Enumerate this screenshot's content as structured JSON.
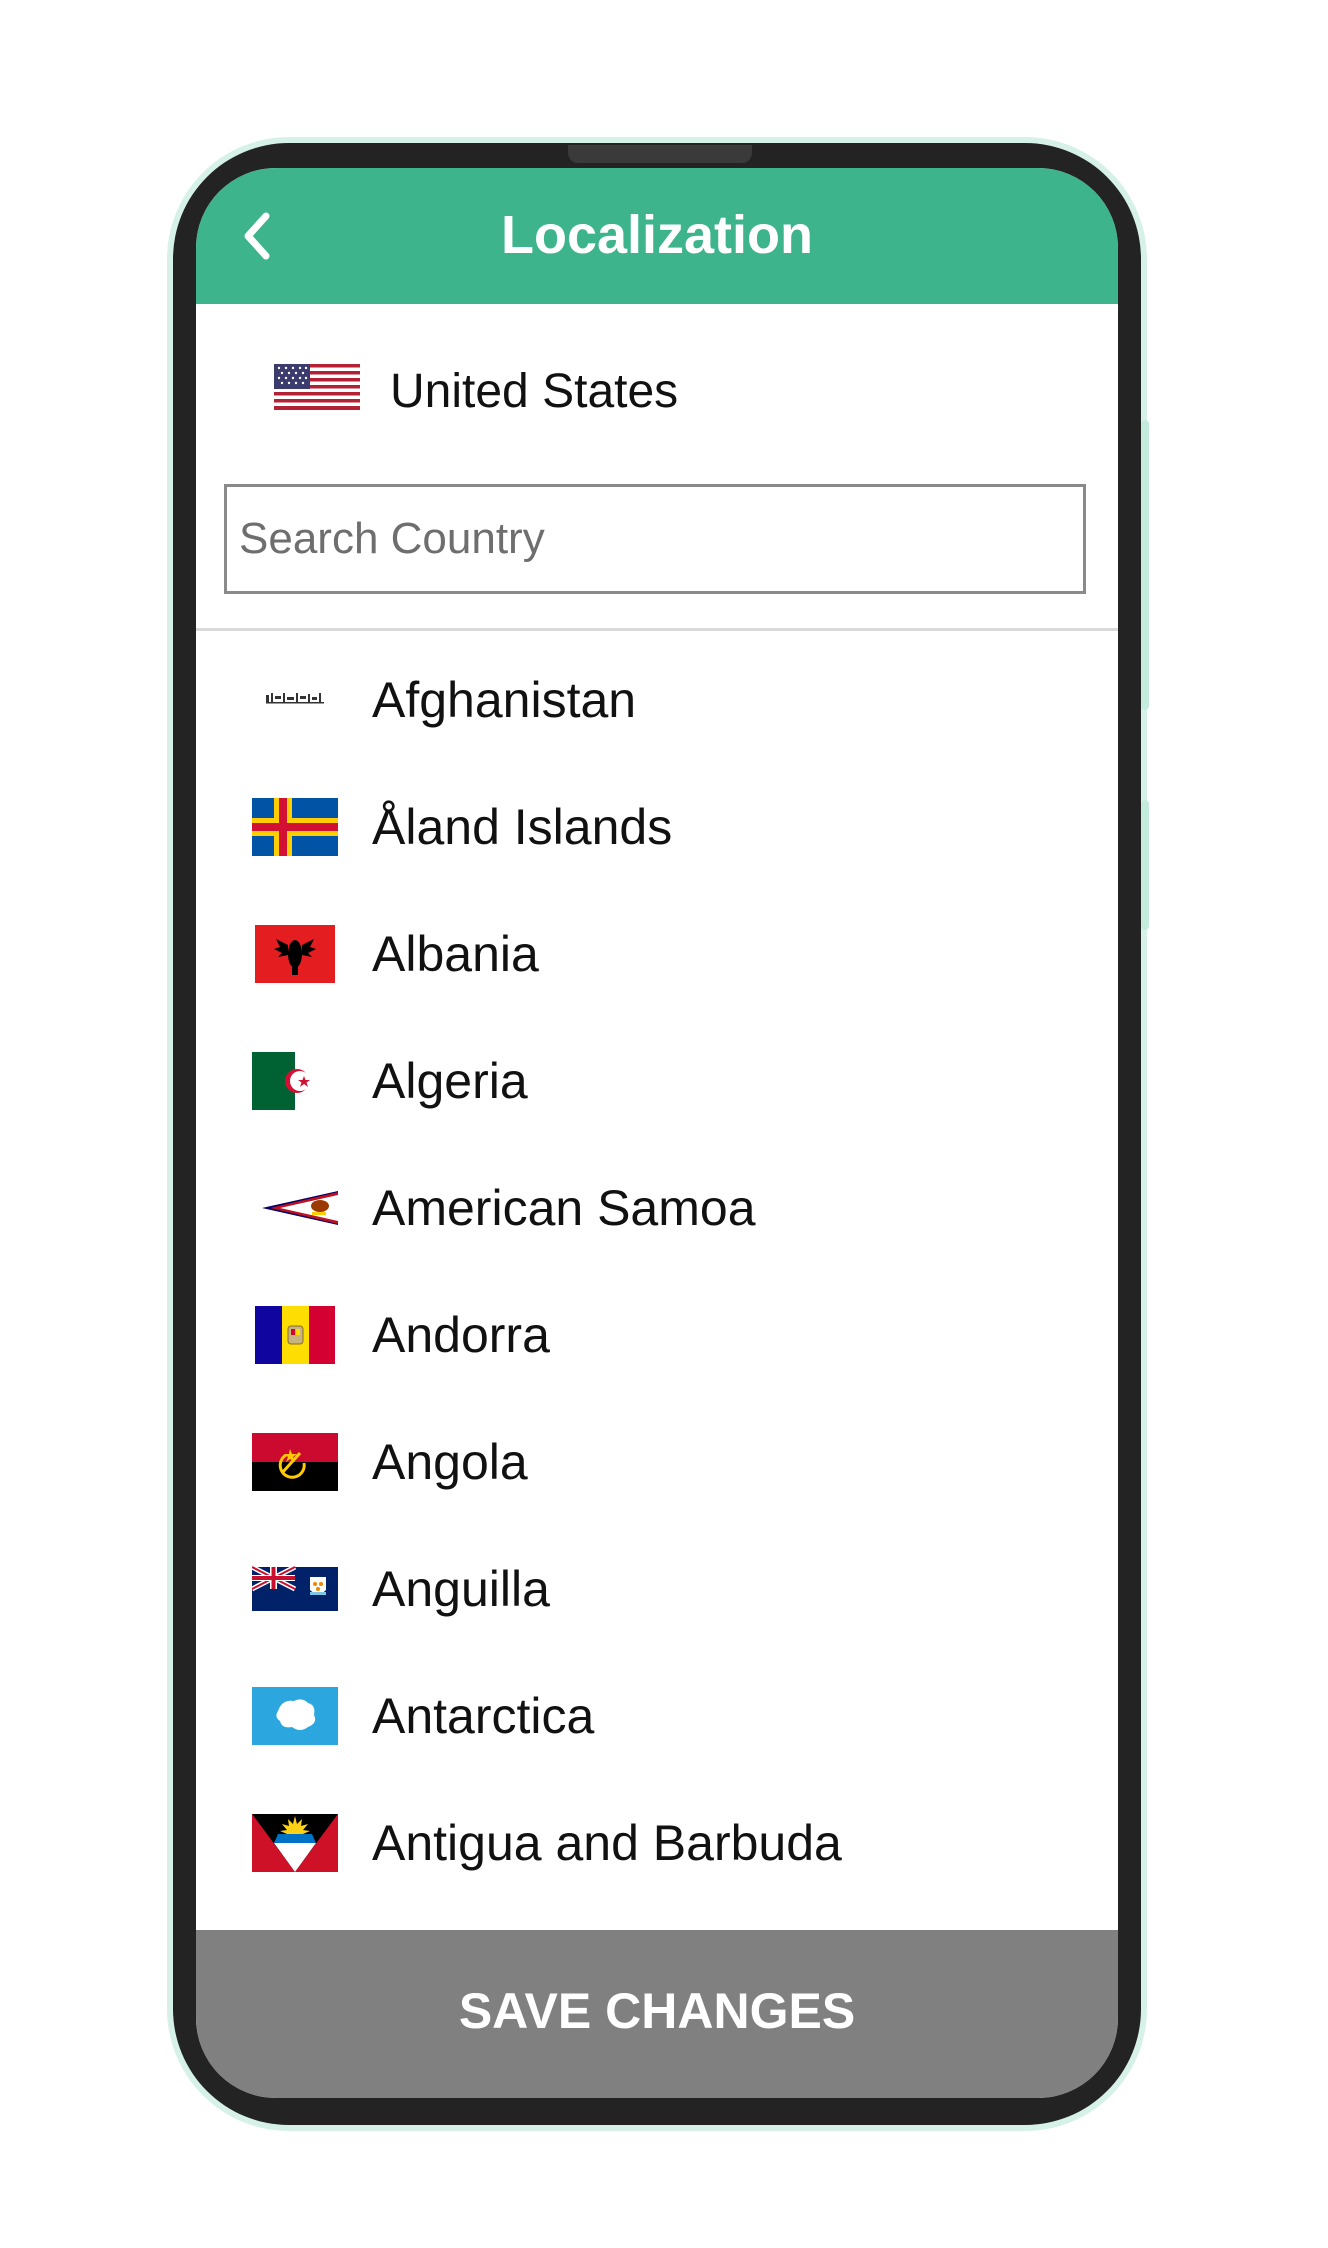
{
  "header": {
    "title": "Localization",
    "back_icon": "chevron-left-icon"
  },
  "selected_country": {
    "name": "United States",
    "flag_icon": "flag-us-icon"
  },
  "search": {
    "placeholder": "Search Country",
    "value": ""
  },
  "countries": [
    {
      "name": "Afghanistan",
      "flag_icon": "flag-af-icon"
    },
    {
      "name": "Åland Islands",
      "flag_icon": "flag-ax-icon"
    },
    {
      "name": "Albania",
      "flag_icon": "flag-al-icon"
    },
    {
      "name": "Algeria",
      "flag_icon": "flag-dz-icon"
    },
    {
      "name": "American Samoa",
      "flag_icon": "flag-as-icon"
    },
    {
      "name": "Andorra",
      "flag_icon": "flag-ad-icon"
    },
    {
      "name": "Angola",
      "flag_icon": "flag-ao-icon"
    },
    {
      "name": "Anguilla",
      "flag_icon": "flag-ai-icon"
    },
    {
      "name": "Antarctica",
      "flag_icon": "flag-aq-icon"
    },
    {
      "name": "Antigua and Barbuda",
      "flag_icon": "flag-ag-icon"
    }
  ],
  "footer": {
    "save_label": "SAVE CHANGES"
  },
  "colors": {
    "header": "#3db48c",
    "save_button": "#808080",
    "phone_frame": "#232323"
  }
}
